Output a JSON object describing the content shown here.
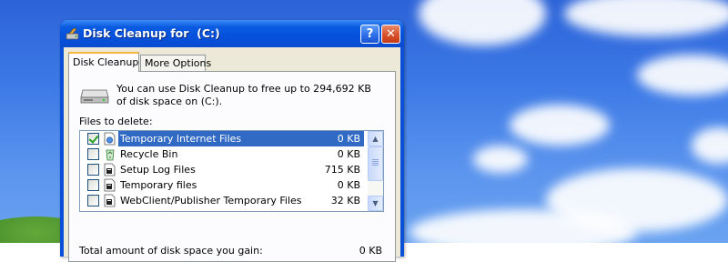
{
  "window": {
    "title": "Disk Cleanup for  (C:)",
    "help_glyph": "?",
    "close_glyph": "✕"
  },
  "tabs": [
    {
      "label": "Disk Cleanup",
      "active": true
    },
    {
      "label": "More Options",
      "active": false
    }
  ],
  "description": "You can use Disk Cleanup to free up to 294,692 KB of disk space on  (C:).",
  "files_label": "Files to delete:",
  "files": [
    {
      "name": "Temporary Internet Files",
      "size": "0 KB",
      "checked": true,
      "selected": true,
      "icon": "temp-internet-files-icon"
    },
    {
      "name": "Recycle Bin",
      "size": "0 KB",
      "checked": false,
      "selected": false,
      "icon": "recycle-bin-icon"
    },
    {
      "name": "Setup Log Files",
      "size": "715 KB",
      "checked": false,
      "selected": false,
      "icon": "log-file-icon"
    },
    {
      "name": "Temporary files",
      "size": "0 KB",
      "checked": false,
      "selected": false,
      "icon": "temp-files-icon"
    },
    {
      "name": "WebClient/Publisher Temporary Files",
      "size": "32 KB",
      "checked": false,
      "selected": false,
      "icon": "webclient-files-icon"
    }
  ],
  "scrollbar": {
    "up": "▲",
    "down": "▼"
  },
  "total": {
    "label": "Total amount of disk space you gain:",
    "value": "0 KB"
  },
  "colors": {
    "title_bar": "#0551dd",
    "selection": "#316ac5",
    "dialog_bg": "#ece9d8",
    "active_tab_accent": "#f6b73c"
  }
}
